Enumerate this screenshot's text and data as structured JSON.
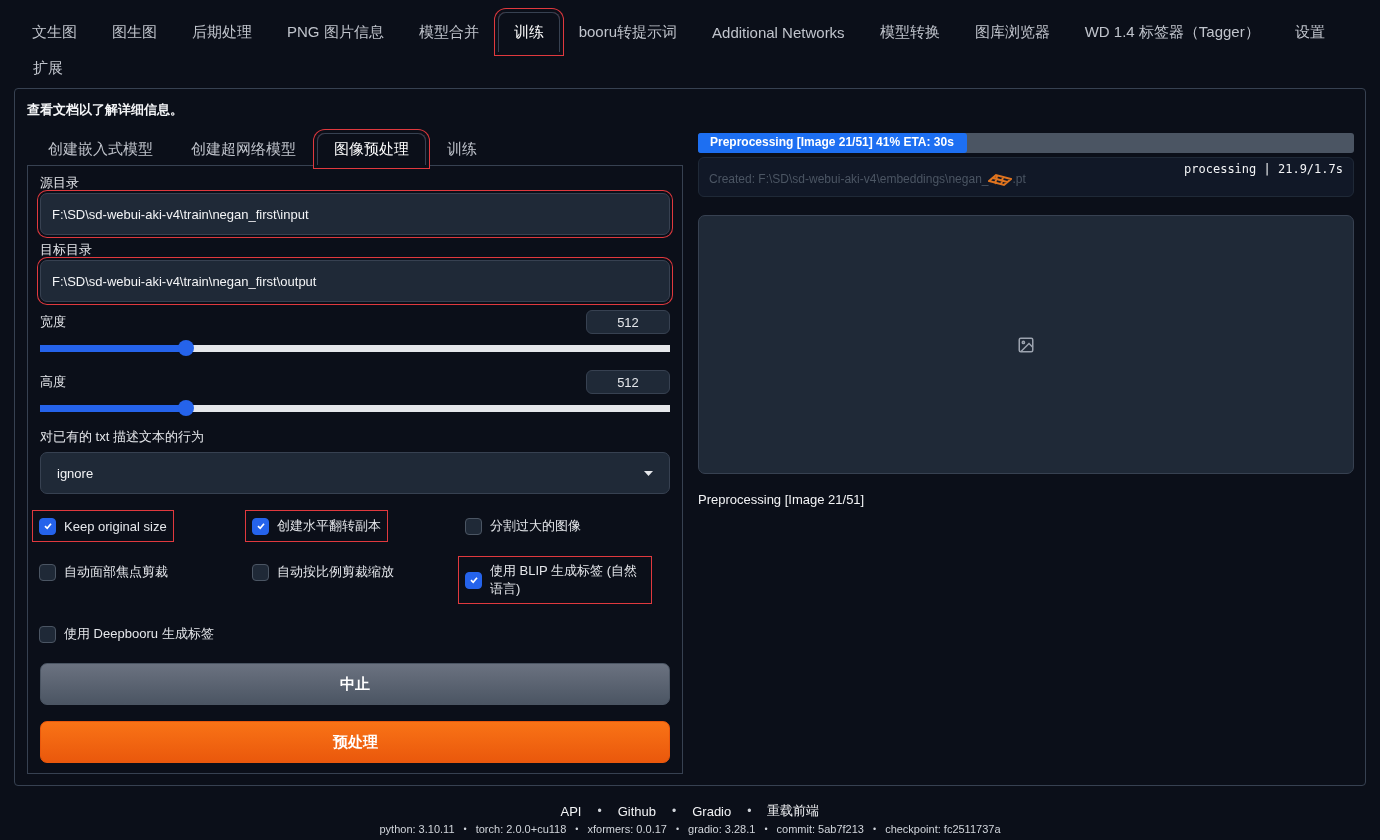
{
  "tabs": [
    {
      "label": "文生图",
      "selected": false,
      "annotated": false
    },
    {
      "label": "图生图",
      "selected": false,
      "annotated": false
    },
    {
      "label": "后期处理",
      "selected": false,
      "annotated": false
    },
    {
      "label": "PNG 图片信息",
      "selected": false,
      "annotated": false
    },
    {
      "label": "模型合并",
      "selected": false,
      "annotated": false
    },
    {
      "label": "训练",
      "selected": true,
      "annotated": true
    },
    {
      "label": "booru转提示词",
      "selected": false,
      "annotated": false
    },
    {
      "label": "Additional Networks",
      "selected": false,
      "annotated": false
    },
    {
      "label": "模型转换",
      "selected": false,
      "annotated": false
    },
    {
      "label": "图库浏览器",
      "selected": false,
      "annotated": false
    },
    {
      "label": "WD 1.4 标签器（Tagger）",
      "selected": false,
      "annotated": false
    },
    {
      "label": "设置",
      "selected": false,
      "annotated": false
    },
    {
      "label": "扩展",
      "selected": false,
      "annotated": false
    }
  ],
  "doc_note": "查看**文档**以了解详细信息。",
  "sub_tabs": [
    {
      "label": "创建嵌入式模型",
      "selected": false,
      "annotated": false
    },
    {
      "label": "创建超网络模型",
      "selected": false,
      "annotated": false
    },
    {
      "label": "图像预处理",
      "selected": true,
      "annotated": true
    },
    {
      "label": "训练",
      "selected": false,
      "annotated": false
    }
  ],
  "fields": [
    {
      "label": "源目录",
      "value": "F:\\SD\\sd-webui-aki-v4\\train\\negan_first\\input",
      "annotated": true
    },
    {
      "label": "目标目录",
      "value": "F:\\SD\\sd-webui-aki-v4\\train\\negan_first\\output",
      "annotated": true
    }
  ],
  "sliders": [
    {
      "label": "宽度",
      "value": "512",
      "level": 0.232
    },
    {
      "label": "高度",
      "value": "512",
      "level": 0.232
    }
  ],
  "dropdown": {
    "label": "对已有的 txt 描述文本的行为",
    "value": "ignore"
  },
  "checkboxes": [
    {
      "label": "Keep original size",
      "checked": true,
      "annotated": true
    },
    {
      "label": "创建水平翻转副本",
      "checked": true,
      "annotated": true
    },
    {
      "label": "分割过大的图像",
      "checked": false,
      "annotated": false
    },
    {
      "label": "自动面部焦点剪裁",
      "checked": false,
      "annotated": false
    },
    {
      "label": "自动按比例剪裁缩放",
      "checked": false,
      "annotated": false
    },
    {
      "label": "使用 BLIP 生成标签 (自然语言)",
      "checked": true,
      "annotated": true
    },
    {
      "label": "使用 Deepbooru 生成标签",
      "checked": false,
      "annotated": false
    }
  ],
  "buttons": [
    {
      "label": "中止",
      "kind": "secondary"
    },
    {
      "label": "预处理",
      "kind": "primary"
    }
  ],
  "progress": {
    "label": "Preprocessing [Image 21/51] 41% ETA: 30s",
    "level": 0.41
  },
  "status": {
    "created_start": "Created: F:\\SD\\sd-webui-aki-v4\\embeddings\\negan_",
    "created_end": ".pt",
    "timing": "processing | 21.9/1.7s"
  },
  "result_caption": "Preprocessing [Image 21/51]",
  "footer": {
    "links": [
      {
        "kind": "link",
        "text": "API"
      },
      {
        "kind": "separator",
        "text": "•"
      },
      {
        "kind": "link",
        "text": "Github"
      },
      {
        "kind": "separator",
        "text": "•"
      },
      {
        "kind": "link",
        "text": "Gradio"
      },
      {
        "kind": "separator",
        "text": "•"
      },
      {
        "kind": "link",
        "text": "重载前端"
      }
    ],
    "versions": [
      {
        "kind": "info",
        "text": "python: 3.10.11"
      },
      {
        "kind": "separator",
        "text": "•"
      },
      {
        "kind": "info",
        "text": "torch: 2.0.0+cu118"
      },
      {
        "kind": "separator",
        "text": "•"
      },
      {
        "kind": "info",
        "text": "xformers: 0.0.17"
      },
      {
        "kind": "separator",
        "text": "•"
      },
      {
        "kind": "info",
        "text": "gradio: 3.28.1"
      },
      {
        "kind": "separator",
        "text": "•"
      },
      {
        "kind": "info",
        "text": "commit: 5ab7f213"
      },
      {
        "kind": "separator",
        "text": "•"
      },
      {
        "kind": "info",
        "text": "checkpoint: fc2511737a"
      }
    ]
  }
}
